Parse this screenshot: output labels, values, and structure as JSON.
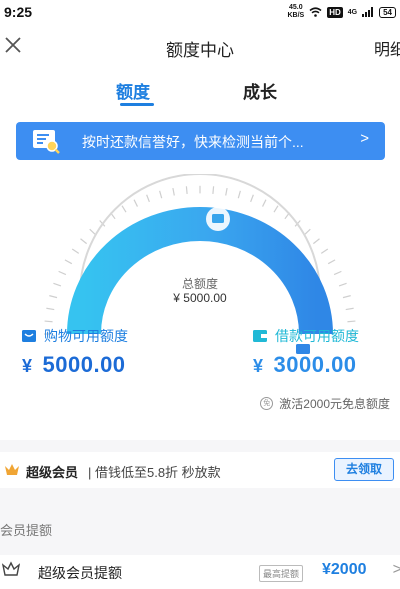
{
  "status_bar": {
    "time": "9:25",
    "speed_value": "45.0",
    "speed_unit": "KB/S",
    "hd_badge": "HD",
    "network": "4G",
    "battery": "54"
  },
  "nav": {
    "title": "额度中心",
    "right_action": "明细"
  },
  "tabs": [
    {
      "label": "额度",
      "active": true
    },
    {
      "label": "成长",
      "active": false
    }
  ],
  "banner": {
    "text": "按时还款信誉好，快来检测当前个...",
    "arrow": ">"
  },
  "gauge": {
    "label": "总额度",
    "value": "¥ 5000.00",
    "fill_fraction": 1.0,
    "colors": {
      "left": "#36c3f0",
      "right": "#2f87e6",
      "track": "#d6d6d6"
    }
  },
  "limits": {
    "shopping": {
      "label": "购物可用额度",
      "currency": "¥",
      "amount": "5000.00",
      "color": "#1c6bd6"
    },
    "loan": {
      "label": "借款可用额度",
      "currency": "¥",
      "amount": "3000.00",
      "color": "#21b9d6"
    }
  },
  "activate": {
    "icon_text": "免",
    "text": "激活2000元免息额度"
  },
  "vip": {
    "title": "超级会员",
    "desc": "| 借钱低至5.8折 秒放款",
    "button": "去领取"
  },
  "section": {
    "title": "会员提额"
  },
  "vip_row": {
    "label": "超级会员提额",
    "badge": "最高提额",
    "amount": "¥2000",
    "chevron": ">"
  }
}
